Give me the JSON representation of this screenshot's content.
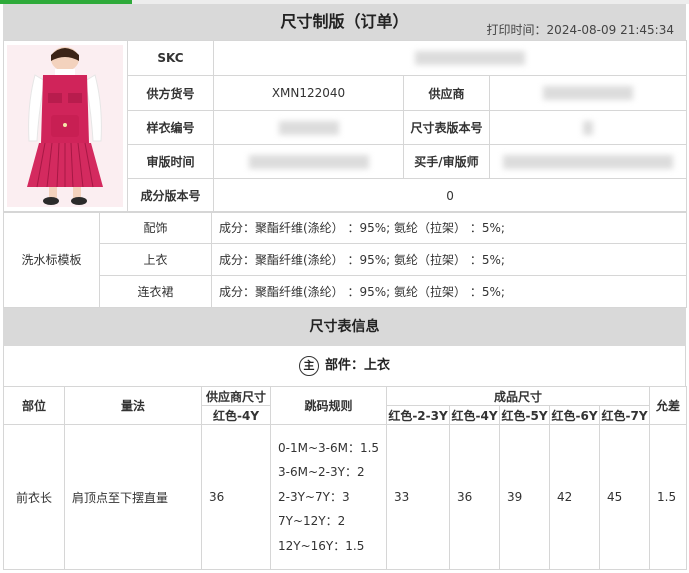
{
  "header": {
    "title": "尺寸制版（订单）",
    "print_time": "打印时间：2024-08-09 21:45:34"
  },
  "info": {
    "skc_label": "SKC",
    "supplier_item_label": "供方货号",
    "supplier_item_value": "XMN122040",
    "supplier_label": "供应商",
    "sample_no_label": "样衣编号",
    "size_version_label": "尺寸表版本号",
    "review_time_label": "审版时间",
    "buyer_label": "买手/审版师",
    "composition_version_label": "成分版本号",
    "composition_version_value": "0"
  },
  "care_label": {
    "title": "洗水标模板",
    "rows": [
      {
        "name": "配饰",
        "value": "成分：聚酯纤维(涤纶）  ：95%;  氨纶（拉架）   ：5%;"
      },
      {
        "name": "上衣",
        "value": "成分：聚酯纤维(涤纶）  ：95%;  氨纶（拉架）   ：5%;"
      },
      {
        "name": "连衣裙",
        "value": "成分：聚酯纤维(涤纶）  ：95%;  氨纶（拉架）   ：5%;"
      }
    ]
  },
  "size_section": {
    "title": "尺寸表信息",
    "part_badge": "主",
    "part_label": "部件：上衣"
  },
  "size_table": {
    "h_position": "部位",
    "h_method": "量法",
    "h_supplier_size": "供应商尺寸",
    "h_supplier_size_sub": "红色-4Y",
    "h_grading": "跳码规则",
    "h_finished": "成品尺寸",
    "h_tolerance": "允差",
    "finished_sizes": [
      "红色-2-3Y",
      "红色-4Y",
      "红色-5Y",
      "红色-6Y",
      "红色-7Y"
    ],
    "row": {
      "position": "前衣长",
      "method": "肩顶点至下摆直量",
      "supplier_value": "36",
      "rules": [
        "0-1M~3-6M：1.5",
        "3-6M~2-3Y：2",
        "2-3Y~7Y：3",
        "7Y~12Y：2",
        "12Y~16Y：1.5"
      ],
      "values": [
        "33",
        "36",
        "39",
        "42",
        "45"
      ],
      "tolerance": "1.5"
    }
  }
}
